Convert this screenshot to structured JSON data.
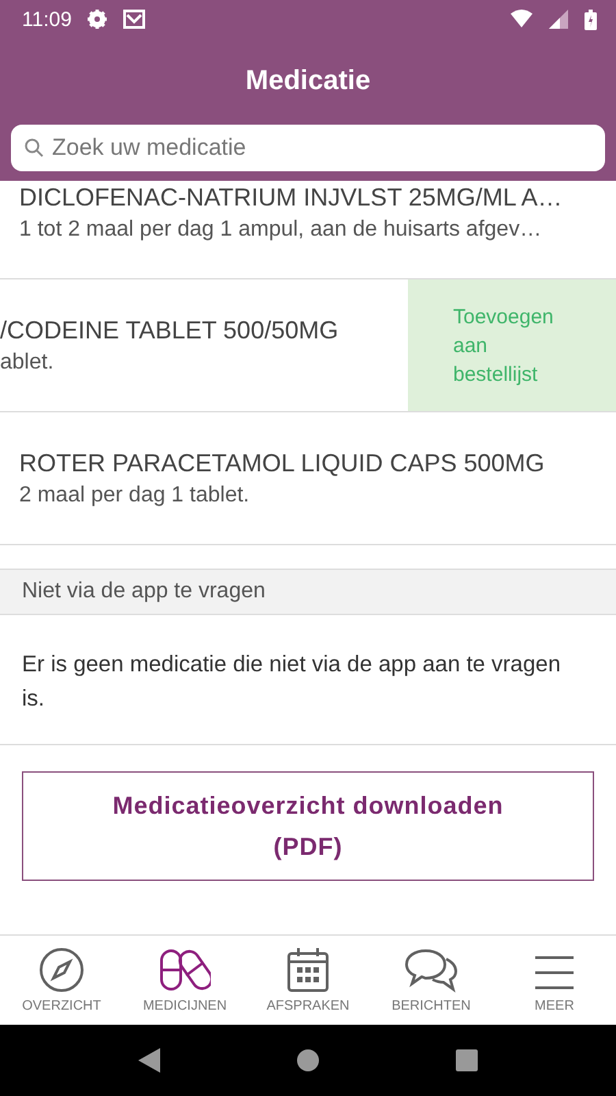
{
  "status_bar": {
    "time": "11:09"
  },
  "header": {
    "title": "Medicatie"
  },
  "search": {
    "placeholder": "Zoek uw medicatie"
  },
  "medications": [
    {
      "name": "DICLOFENAC-NATRIUM INJVLST 25MG/ML A…",
      "dosage": "1 tot 2 maal per dag 1 ampul, aan de huisarts afgev…",
      "swiped": false
    },
    {
      "name": "/CODEINE TABLET 500/50MG",
      "dosage": "ablet.",
      "swiped": true,
      "action": "Toevoegen aan bestellijst"
    },
    {
      "name": "ROTER PARACETAMOL LIQUID CAPS 500MG",
      "dosage": "2 maal per dag 1 tablet.",
      "swiped": false
    }
  ],
  "section": {
    "title": "Niet via de app te vragen",
    "message": "Er is geen medicatie die niet via de app aan te vragen is."
  },
  "download_button": "Medicatieoverzicht downloaden (PDF)",
  "tabs": [
    {
      "kind": "compass",
      "label": "OVERZICHT",
      "selected": false
    },
    {
      "kind": "pills",
      "label": "MEDICIJNEN",
      "selected": true
    },
    {
      "kind": "calendar",
      "label": "AFSPRAKEN",
      "selected": false
    },
    {
      "kind": "chat",
      "label": "BERICHTEN",
      "selected": false
    },
    {
      "kind": "menu",
      "label": "MEER",
      "selected": false
    }
  ]
}
